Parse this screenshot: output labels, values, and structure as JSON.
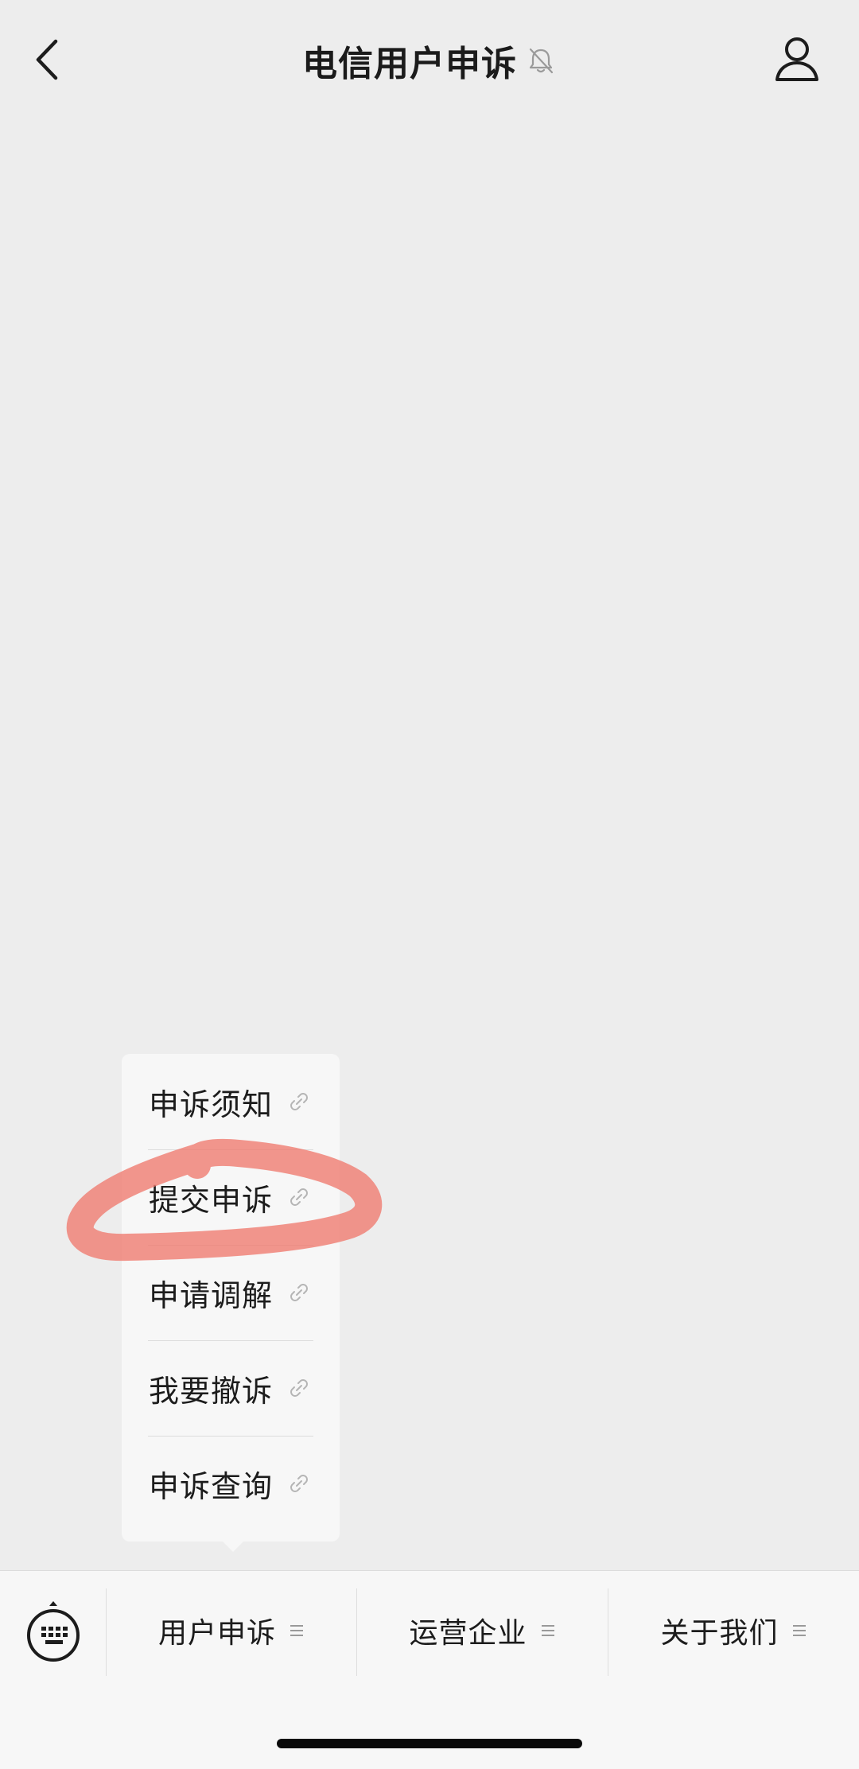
{
  "header": {
    "title": "电信用户申诉",
    "back_icon": "chevron-left-icon",
    "mute_icon": "bell-slash-icon",
    "profile_icon": "person-icon"
  },
  "popup_menu": {
    "items": [
      {
        "label": "申诉须知",
        "icon": "link-icon"
      },
      {
        "label": "提交申诉",
        "icon": "link-icon",
        "annotated": true
      },
      {
        "label": "申请调解",
        "icon": "link-icon"
      },
      {
        "label": "我要撤诉",
        "icon": "link-icon"
      },
      {
        "label": "申诉查询",
        "icon": "link-icon"
      }
    ]
  },
  "bottom_bar": {
    "keyboard_icon": "keyboard-icon",
    "tabs": [
      {
        "label": "用户申诉",
        "icon": "menu-lines-icon"
      },
      {
        "label": "运营企业",
        "icon": "menu-lines-icon"
      },
      {
        "label": "关于我们",
        "icon": "menu-lines-icon"
      }
    ]
  },
  "colors": {
    "background": "#ededed",
    "menu_background": "#f7f7f7",
    "annotation": "#f07a6e",
    "text": "#191919"
  }
}
